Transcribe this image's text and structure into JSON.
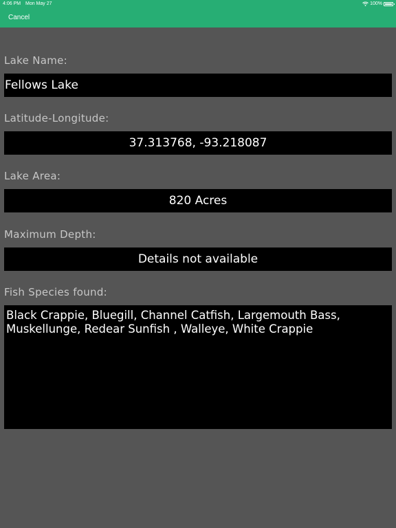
{
  "status_bar": {
    "time": "4:06 PM",
    "date": "Mon May 27",
    "battery": "100%"
  },
  "nav": {
    "cancel_label": "Cancel"
  },
  "fields": {
    "lake_name": {
      "label": "Lake Name:",
      "value": "Fellows Lake"
    },
    "lat_long": {
      "label": "Latitude-Longitude:",
      "value": "37.313768, -93.218087"
    },
    "lake_area": {
      "label": "Lake Area:",
      "value": "820 Acres"
    },
    "max_depth": {
      "label": "Maximum Depth:",
      "value": "Details not available"
    },
    "fish_species": {
      "label": "Fish Species found:",
      "value": "Black Crappie, Bluegill, Channel Catfish, Largemouth Bass, Muskellunge, Redear Sunfish , Walleye, White Crappie"
    }
  },
  "colors": {
    "nav_bar": "#27ae74",
    "background": "#555555",
    "field_background": "#000000",
    "label_text": "#c7c7c7"
  },
  "icons": [
    "wifi-icon",
    "battery-icon"
  ]
}
